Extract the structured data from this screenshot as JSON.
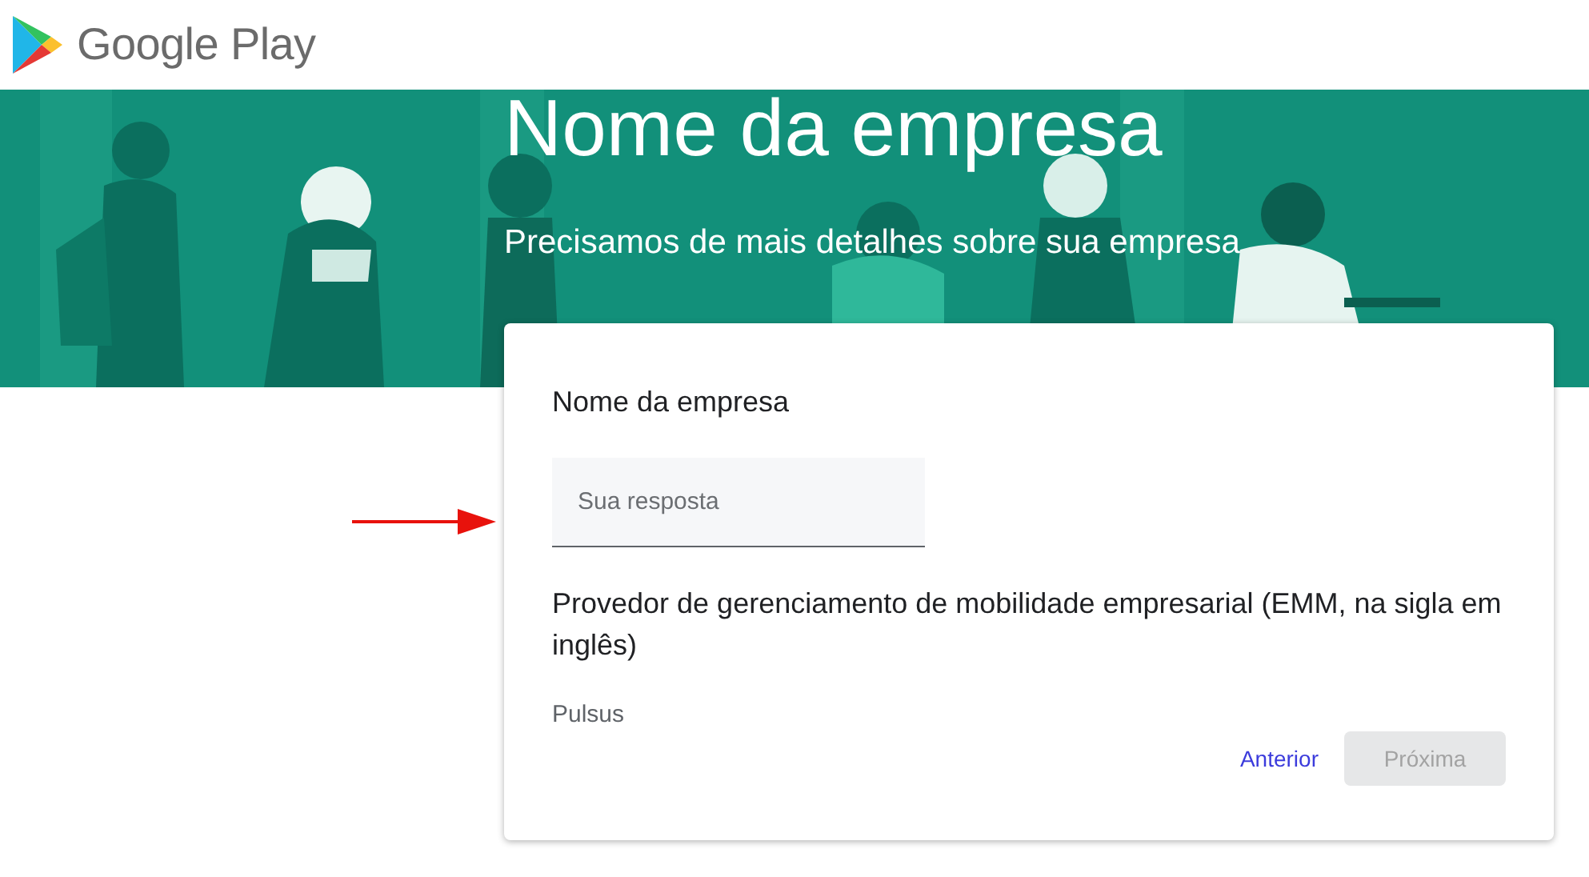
{
  "header": {
    "logo_text": "Google Play"
  },
  "banner": {
    "title": "Nome da empresa",
    "subtitle": "Precisamos de mais detalhes sobre sua empresa"
  },
  "form": {
    "questions": [
      {
        "kind": "text-input",
        "label": "Nome da empresa",
        "placeholder": "Sua resposta"
      },
      {
        "kind": "answer",
        "label": "Provedor de gerenciamento de mobilidade empresarial (EMM, na sigla em inglês)",
        "value": "Pulsus"
      }
    ],
    "buttons": [
      {
        "kind": "link",
        "label": "Anterior",
        "disabled": false
      },
      {
        "kind": "filled",
        "label": "Próxima",
        "disabled": true
      }
    ]
  }
}
